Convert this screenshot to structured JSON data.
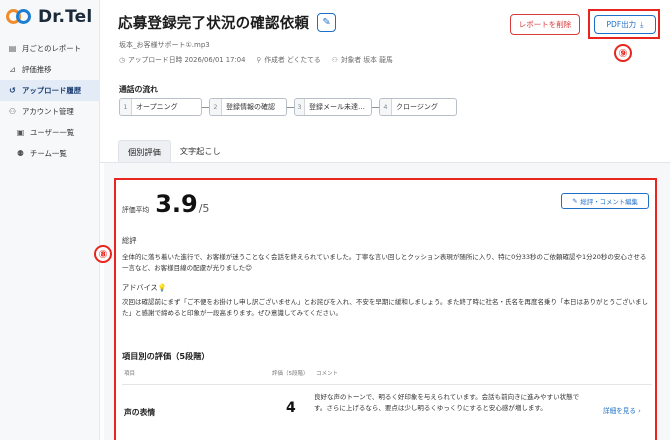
{
  "sidebar": {
    "brand": "Dr.Tel",
    "items": [
      {
        "label": "月ごとのレポート",
        "icon": "document-icon"
      },
      {
        "label": "評価推移",
        "icon": "chart-icon"
      },
      {
        "label": "アップロード履歴",
        "icon": "history-icon",
        "active": true
      },
      {
        "label": "アカウント管理",
        "icon": "users-icon"
      },
      {
        "label": "ユーザー一覧",
        "icon": "user-card-icon"
      },
      {
        "label": "チーム一覧",
        "icon": "team-icon"
      }
    ]
  },
  "header": {
    "title": "応募登録完了状況の確認依頼",
    "filename": "坂本_お客様サポート①.mp3",
    "upload_datetime": "アップロード日時 2026/06/01 17:04",
    "author": "作成者 どくたてる",
    "target": "対象者 坂本 龍馬",
    "delete_label": "レポートを削除",
    "pdf_label": "PDF出力",
    "badge_pdf": "⑨",
    "badge_panel": "⑧"
  },
  "flow": {
    "title": "通話の流れ",
    "steps": [
      {
        "num": "1",
        "label": "オープニング"
      },
      {
        "num": "2",
        "label": "登録情報の確認"
      },
      {
        "num": "3",
        "label": "登録メール未達…"
      },
      {
        "num": "4",
        "label": "クロージング"
      }
    ]
  },
  "tabs": [
    {
      "label": "個別評価",
      "active": true
    },
    {
      "label": "文字起こし",
      "active": false
    }
  ],
  "evaluation": {
    "avg_label": "評価平均",
    "avg_value": "3.9",
    "avg_max": "/5",
    "edit_comment_label": "総評・コメント編集",
    "summary_label": "総評",
    "summary_text": "全体的に落ち着いた進行で、お客様が迷うことなく会話を終えられていました。丁寧な言い回しとクッション表現が随所に入り、特に0分33秒のご依頼確認や1分20秒の安心させる一言など、お客様目線の配慮が光りました😊",
    "advice_label": "アドバイス💡",
    "advice_text": "次回は確認前にまず「ご不便をお掛けし申し訳ございません」とお詫びを入れ、不安を早期に緩和しましょう。また終了時に社名・氏名を再度名乗り「本日はありがとうございました」と感謝で締めると印象が一段高まります。ぜひ意識してみてください。",
    "items_title": "項目別の評価（5段階）",
    "col_item": "項目",
    "col_score": "評価（5段階）",
    "col_comment": "コメント",
    "rows": [
      {
        "name": "声の表情",
        "score": "4",
        "comment": "良好な声のトーンで、明るく好印象を与えられています。会話も前向きに進みやすい状態です。さらに上げるなら、要点は少し明るくゆっくりにすると安心感が増します。",
        "link": "詳細を見る ›"
      }
    ]
  },
  "colors": {
    "accent": "#1e6fc7",
    "danger": "#d93a3a",
    "highlight": "#e8261f",
    "active_nav_bg": "#e3ebf7"
  }
}
